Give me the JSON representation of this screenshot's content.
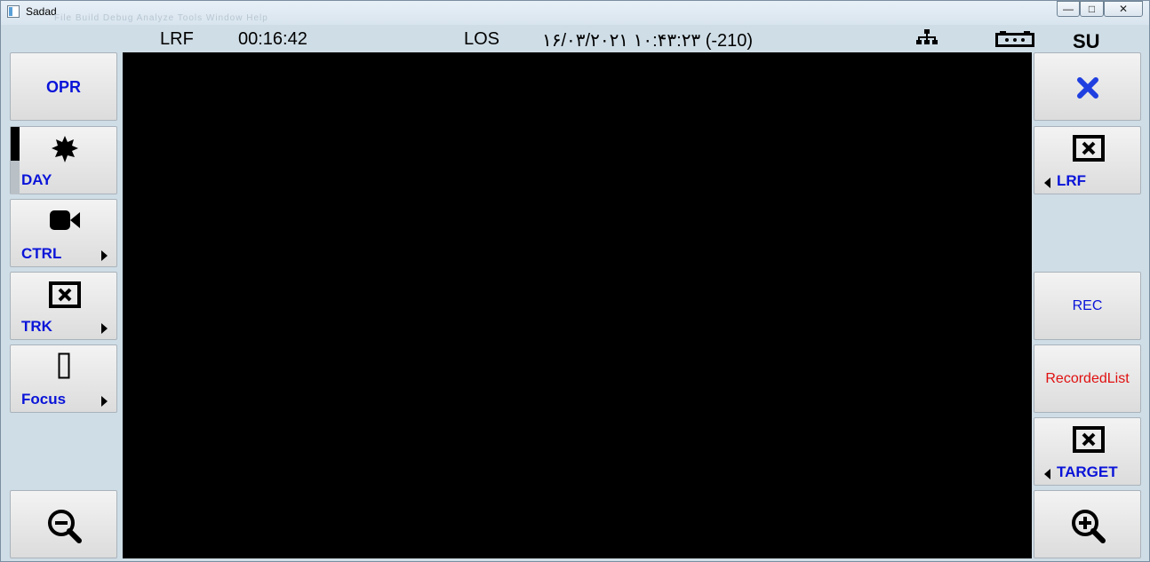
{
  "window": {
    "title": "Sadad",
    "ghost_menu": "File   Build   Debug   Analyze   Tools   Window   Help",
    "controls": {
      "minimize": "—",
      "maximize": "□",
      "close": "✕"
    }
  },
  "status": {
    "mode": "LRF",
    "elapsed": "00:16:42",
    "los": "LOS",
    "datetime": "۱۶/۰۳/۲۰۲۱ ۱۰:۴۳:۲۳ (-210)",
    "user": "SU",
    "icons": [
      "network-icon",
      "battery-icon"
    ]
  },
  "left_panel": {
    "opr": "OPR",
    "day": "DAY",
    "ctrl": "CTRL",
    "trk": "TRK",
    "focus": "Focus",
    "day_level": 0.5
  },
  "right_panel": {
    "lrf": "LRF",
    "rec": "REC",
    "recorded_list": "RecordedList",
    "target": "TARGET"
  },
  "colors": {
    "label_blue": "#0a14d8",
    "close_blue": "#1f3fe0",
    "recorded_red": "#e01010",
    "background": "#cfdde6",
    "video": "#000000"
  }
}
